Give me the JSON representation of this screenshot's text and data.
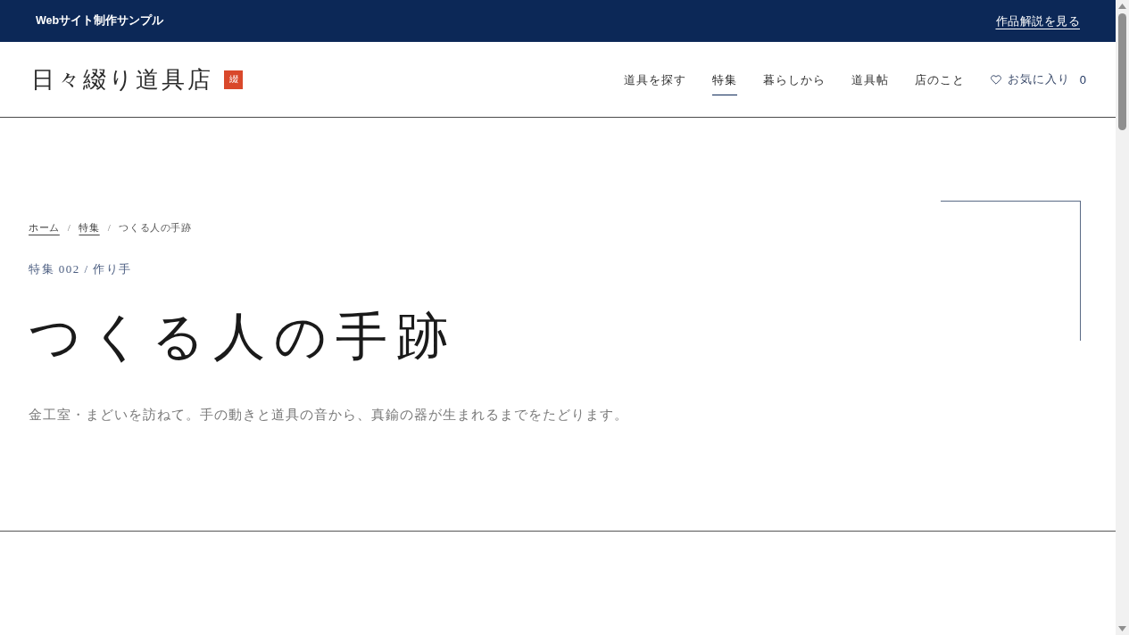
{
  "top_bar": {
    "label": "Webサイト制作サンプル",
    "link": "作品解説を見る"
  },
  "header": {
    "logo": {
      "text": "日々綴り道具店",
      "badge": "綴"
    },
    "nav": [
      {
        "label": "道具を探す",
        "selected": false
      },
      {
        "label": "特集",
        "selected": true
      },
      {
        "label": "暮らしから",
        "selected": false
      },
      {
        "label": "道具帖",
        "selected": false
      },
      {
        "label": "店のこと",
        "selected": false
      }
    ],
    "favorites": {
      "label": "お気に入り",
      "count": "0"
    }
  },
  "hero": {
    "breadcrumb": [
      {
        "kind": "link",
        "label": "ホーム"
      },
      {
        "kind": "separator",
        "label": "/"
      },
      {
        "kind": "link",
        "label": "特集"
      },
      {
        "kind": "separator",
        "label": "/"
      },
      {
        "kind": "current",
        "label": "つくる人の手跡"
      }
    ],
    "eyebrow": "特集 002 / 作り手",
    "title": "つくる人の手跡",
    "lead": "金工室・まどいを訪ねて。手の動きと道具の音から、真鍮の器が生まれるまでをたどります。"
  }
}
